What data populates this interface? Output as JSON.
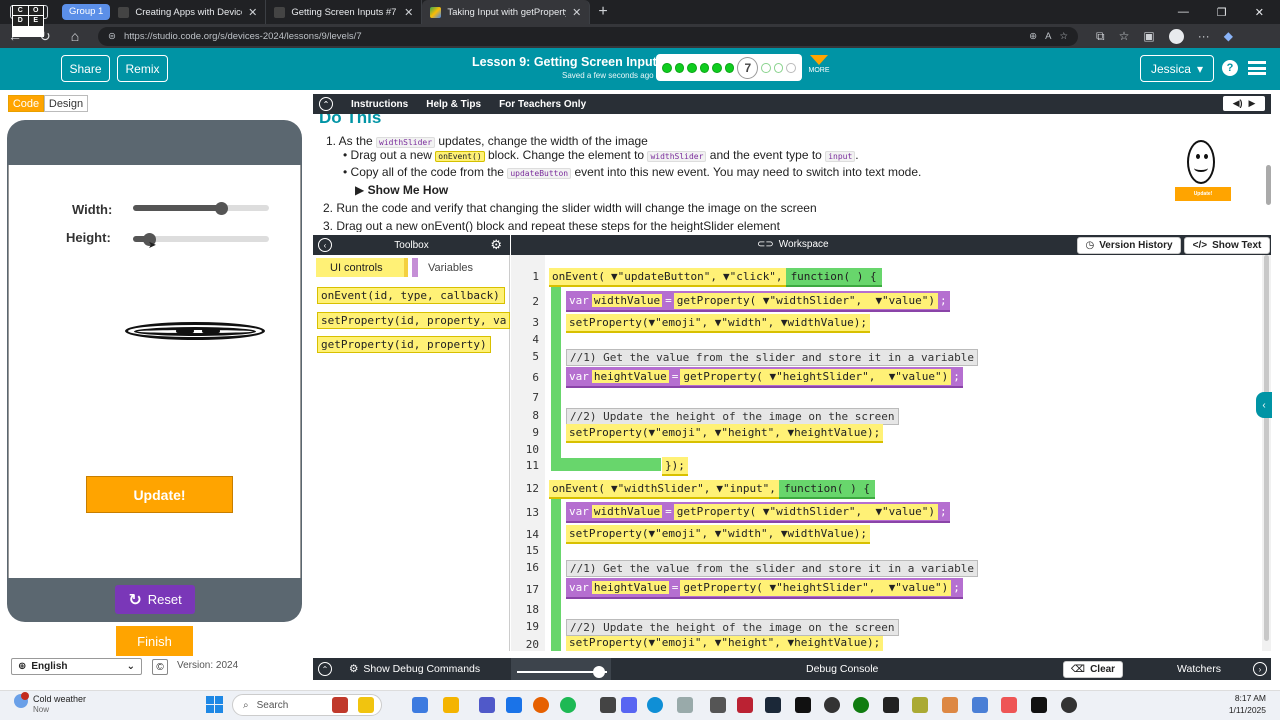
{
  "browser": {
    "tab_group": "Group 1",
    "tabs": [
      {
        "title": "Creating Apps with Devices - Circ",
        "active": false
      },
      {
        "title": "Getting Screen Inputs #7 | Creatin",
        "active": false
      },
      {
        "title": "Taking Input with getProperty.pdf",
        "active": true
      }
    ],
    "url": "https://studio.code.org/s/devices-2024/lessons/9/levels/7"
  },
  "header": {
    "logo_letters": [
      "C",
      "O",
      "D",
      "E",
      "",
      ""
    ],
    "share_label": "Share",
    "remix_label": "Remix",
    "lesson_title": "Lesson 9: Getting Screen Inputs",
    "saved_text": "Saved a few seconds ago",
    "current_level": "7",
    "more_label": "MORE",
    "user_name": "Jessica",
    "help_label": "?"
  },
  "left": {
    "code_tab": "Code",
    "design_tab": "Design",
    "width_label": "Width:",
    "height_label": "Height:",
    "width_slider_value": 0.65,
    "height_slider_value": 0.12,
    "update_label": "Update!",
    "reset_label": "Reset",
    "finish_label": "Finish",
    "language": "English",
    "version": "Version: 2024"
  },
  "instructions": {
    "tab_instructions": "Instructions",
    "tab_help": "Help & Tips",
    "tab_teachers": "For Teachers Only",
    "heading": "Do This",
    "line1_a": "1. As the",
    "line1_code": "widthSlider",
    "line1_b": "updates, change the width of the image",
    "b1_a": "Drag out a new",
    "b1_code1": "onEvent()",
    "b1_b": "block. Change the element to",
    "b1_code2": "widthSlider",
    "b1_c": "and the event type to",
    "b1_code3": "input",
    "b1_d": ".",
    "b2_a": "Copy all of the code from the",
    "b2_code": "updateButton",
    "b2_b": "event into this new event. You may need to switch into text mode.",
    "show_me": "▶ Show Me How",
    "line2": "2. Run the code and verify that changing the slider width will change the image on the screen",
    "line3": "3. Drag out a new onEvent() block and repeat these steps for the heightSlider element",
    "preview_button": "Update!"
  },
  "toolbox": {
    "title": "Toolbox",
    "cat_ui": "UI controls",
    "cat_vars": "Variables",
    "blocks": [
      "onEvent(id, type, callback)",
      "setProperty(id, property, va",
      "getProperty(id, property)"
    ]
  },
  "workspace": {
    "title": "Workspace",
    "version_history": "Version History",
    "show_text": "Show Text",
    "line_numbers": [
      "1",
      "2",
      "3",
      "4",
      "5",
      "6",
      "7",
      "8",
      "9",
      "10",
      "11",
      "12",
      "13",
      "14",
      "15",
      "16",
      "17",
      "18",
      "19",
      "20"
    ],
    "code": {
      "l1_fn": "onEvent(",
      "l1_arg1": "▼\"updateButton\",",
      "l1_arg2": "▼\"click\",",
      "l1_func": "function( ) {",
      "l2_var": "var",
      "l2_name": "widthValue",
      "l2_eq": "=",
      "l2_get": "getProperty(",
      "l2_a1": "▼\"widthSlider\",",
      "l2_a2": "▼\"value\")",
      "l2_end": ";",
      "l3": "setProperty(▼\"emoji\", ▼\"width\", ▼widthValue);",
      "l5": "//1) Get the value from the slider and store it in a variable",
      "l6_name": "heightValue",
      "l6_a1": "▼\"heightSlider\",",
      "l6_a2": "▼\"value\")",
      "l8": "//2) Update the height of the image on the screen",
      "l9": "setProperty(▼\"emoji\", ▼\"height\", ▼heightValue);",
      "l11": "});",
      "l12_arg1": "▼\"widthSlider\",",
      "l12_arg2": "▼\"input\",",
      "l12_func": "function( ) {",
      "l13_name": "widthValue",
      "l14": "setProperty(▼\"emoji\", ▼\"width\", ▼widthValue);",
      "l16": "//1) Get the value from the slider and store it in a variable",
      "l17_name": "heightValue",
      "l19": "//2) Update the height of the image on the screen",
      "l20": "setProperty(▼\"emoji\", ▼\"height\", ▼heightValue);"
    }
  },
  "debug": {
    "show_commands": "Show Debug Commands",
    "console": "Debug Console",
    "clear": "Clear",
    "watchers": "Watchers"
  },
  "taskbar": {
    "weather_title": "Cold weather",
    "weather_sub": "Now",
    "search_placeholder": "Search",
    "time": "8:17 AM",
    "date": "1/11/2025"
  },
  "colors": {
    "brand": "#0094a5",
    "orange": "#ffa400",
    "purple": "#7a37b8",
    "block_yellow": "#fff176",
    "block_green": "#68d66c"
  }
}
